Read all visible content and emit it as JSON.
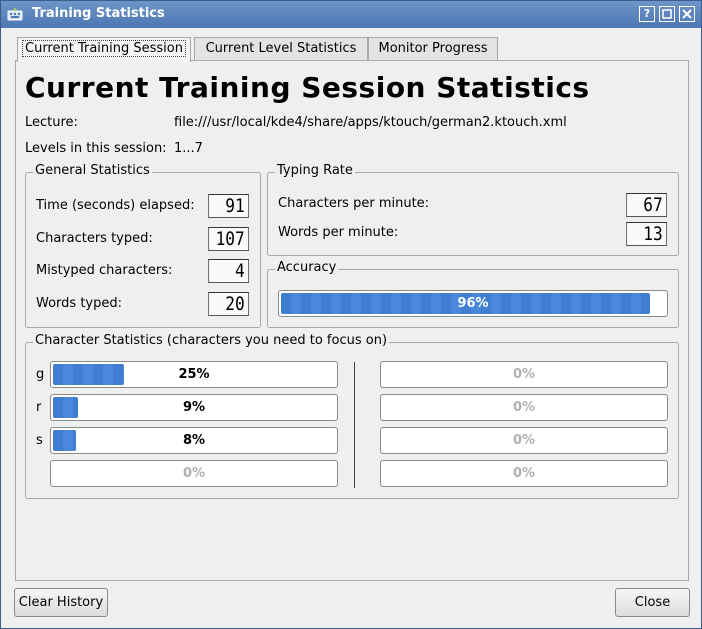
{
  "window": {
    "title": "Training Statistics"
  },
  "tabs": [
    {
      "label": "Current Training Session",
      "active": true
    },
    {
      "label": "Current Level Statistics",
      "active": false
    },
    {
      "label": "Monitor Progress",
      "active": false
    }
  ],
  "session": {
    "heading": "Current Training Session Statistics",
    "lecture_label": "Lecture:",
    "lecture_value": "file:///usr/local/kde4/share/apps/ktouch/german2.ktouch.xml",
    "levels_label": "Levels in this session:",
    "levels_value": "1...7"
  },
  "general": {
    "title": "General Statistics",
    "rows": [
      {
        "label": "Time (seconds) elapsed:",
        "value": "91"
      },
      {
        "label": "Characters typed:",
        "value": "107"
      },
      {
        "label": "Mistyped characters:",
        "value": "4"
      },
      {
        "label": "Words typed:",
        "value": "20"
      }
    ]
  },
  "typing_rate": {
    "title": "Typing Rate",
    "rows": [
      {
        "label": "Characters per minute:",
        "value": "67"
      },
      {
        "label": "Words per minute:",
        "value": "13"
      }
    ]
  },
  "accuracy": {
    "title": "Accuracy",
    "percent": 96,
    "text": "96%"
  },
  "char_stats": {
    "title": "Character Statistics (characters you need to focus on)",
    "left": [
      {
        "char": "g",
        "percent": 25,
        "text": "25%"
      },
      {
        "char": "r",
        "percent": 9,
        "text": "9%"
      },
      {
        "char": "s",
        "percent": 8,
        "text": "8%"
      },
      {
        "char": "",
        "percent": 0,
        "text": "0%"
      }
    ],
    "right": [
      {
        "char": "",
        "percent": 0,
        "text": "0%"
      },
      {
        "char": "",
        "percent": 0,
        "text": "0%"
      },
      {
        "char": "",
        "percent": 0,
        "text": "0%"
      },
      {
        "char": "",
        "percent": 0,
        "text": "0%"
      }
    ]
  },
  "buttons": {
    "clear_history": "Clear History",
    "close": "Close"
  },
  "colors": {
    "accent": "#3f7dd1",
    "titlebar": "#5b83bd"
  }
}
